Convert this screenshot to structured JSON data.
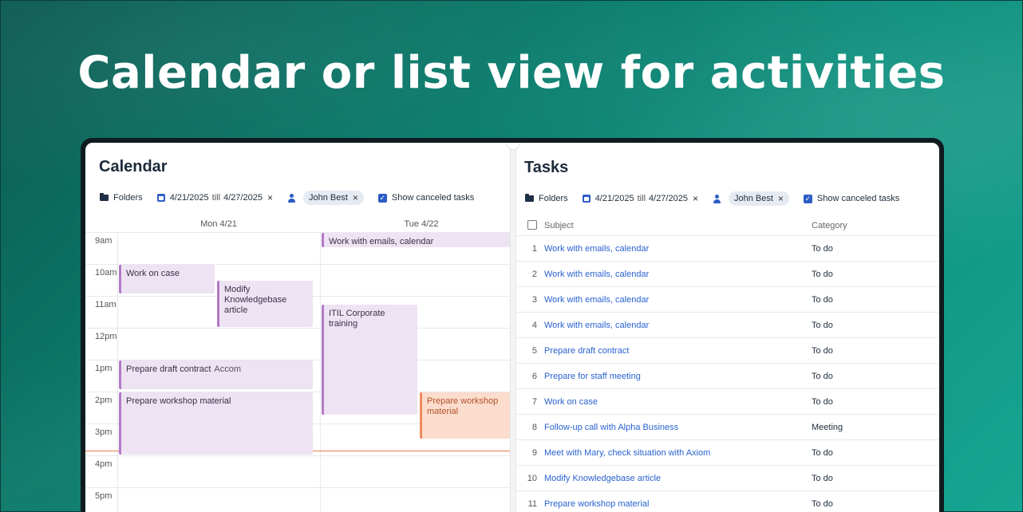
{
  "headline": "Calendar or list view for activities",
  "calendar": {
    "title": "Calendar",
    "filters": {
      "folders": "Folders",
      "date_from": "4/21/2025",
      "till": "till",
      "date_to": "4/27/2025",
      "user": "John Best",
      "show_canceled": "Show canceled tasks"
    },
    "days": [
      "Mon 4/21",
      "Tue 4/22"
    ],
    "hours": [
      "9am",
      "10am",
      "11am",
      "12pm",
      "1pm",
      "2pm",
      "3pm",
      "4pm",
      "5pm"
    ],
    "events": [
      {
        "title": "Work with emails, calendar",
        "day": 1,
        "start": 9.0,
        "end": 9.5
      },
      {
        "title": "Work on case",
        "day": 0,
        "start": 10.0,
        "end": 10.95
      },
      {
        "title": "Modify Knowledgebase article",
        "day": 0,
        "start": 10.5,
        "end": 12.0
      },
      {
        "title": "ITIL Corporate training",
        "day": 1,
        "start": 11.25,
        "end": 14.75
      },
      {
        "title": "Prepare draft contract",
        "extra": "Accom",
        "day": 0,
        "start": 13.0,
        "end": 13.95
      },
      {
        "title": "Prepare workshop material",
        "day": 0,
        "start": 14.0,
        "end": 16.0
      },
      {
        "title": "Prepare workshop material",
        "day": 1,
        "start": 14.0,
        "end": 15.5,
        "color": "orange"
      }
    ],
    "now_hour": 16.0
  },
  "tasks": {
    "title": "Tasks",
    "filters": {
      "folders": "Folders",
      "date_from": "4/21/2025",
      "till": "till",
      "date_to": "4/27/2025",
      "user": "John Best",
      "show_canceled": "Show canceled tasks"
    },
    "columns": {
      "subject": "Subject",
      "category": "Category"
    },
    "rows": [
      {
        "n": "1",
        "subject": "Work with emails, calendar",
        "category": "To do"
      },
      {
        "n": "2",
        "subject": "Work with emails, calendar",
        "category": "To do"
      },
      {
        "n": "3",
        "subject": "Work with emails, calendar",
        "category": "To do"
      },
      {
        "n": "4",
        "subject": "Work with emails, calendar",
        "category": "To do"
      },
      {
        "n": "5",
        "subject": "Prepare draft contract",
        "category": "To do"
      },
      {
        "n": "6",
        "subject": "Prepare for staff meeting",
        "category": "To do"
      },
      {
        "n": "7",
        "subject": "Work on case",
        "category": "To do"
      },
      {
        "n": "8",
        "subject": "Follow-up call with Alpha Business",
        "category": "Meeting"
      },
      {
        "n": "9",
        "subject": "Meet with Mary, check situation with Axiom",
        "category": "To do"
      },
      {
        "n": "10",
        "subject": "Modify Knowledgebase article",
        "category": "To do"
      },
      {
        "n": "11",
        "subject": "Prepare workshop material",
        "category": "To do"
      }
    ]
  }
}
